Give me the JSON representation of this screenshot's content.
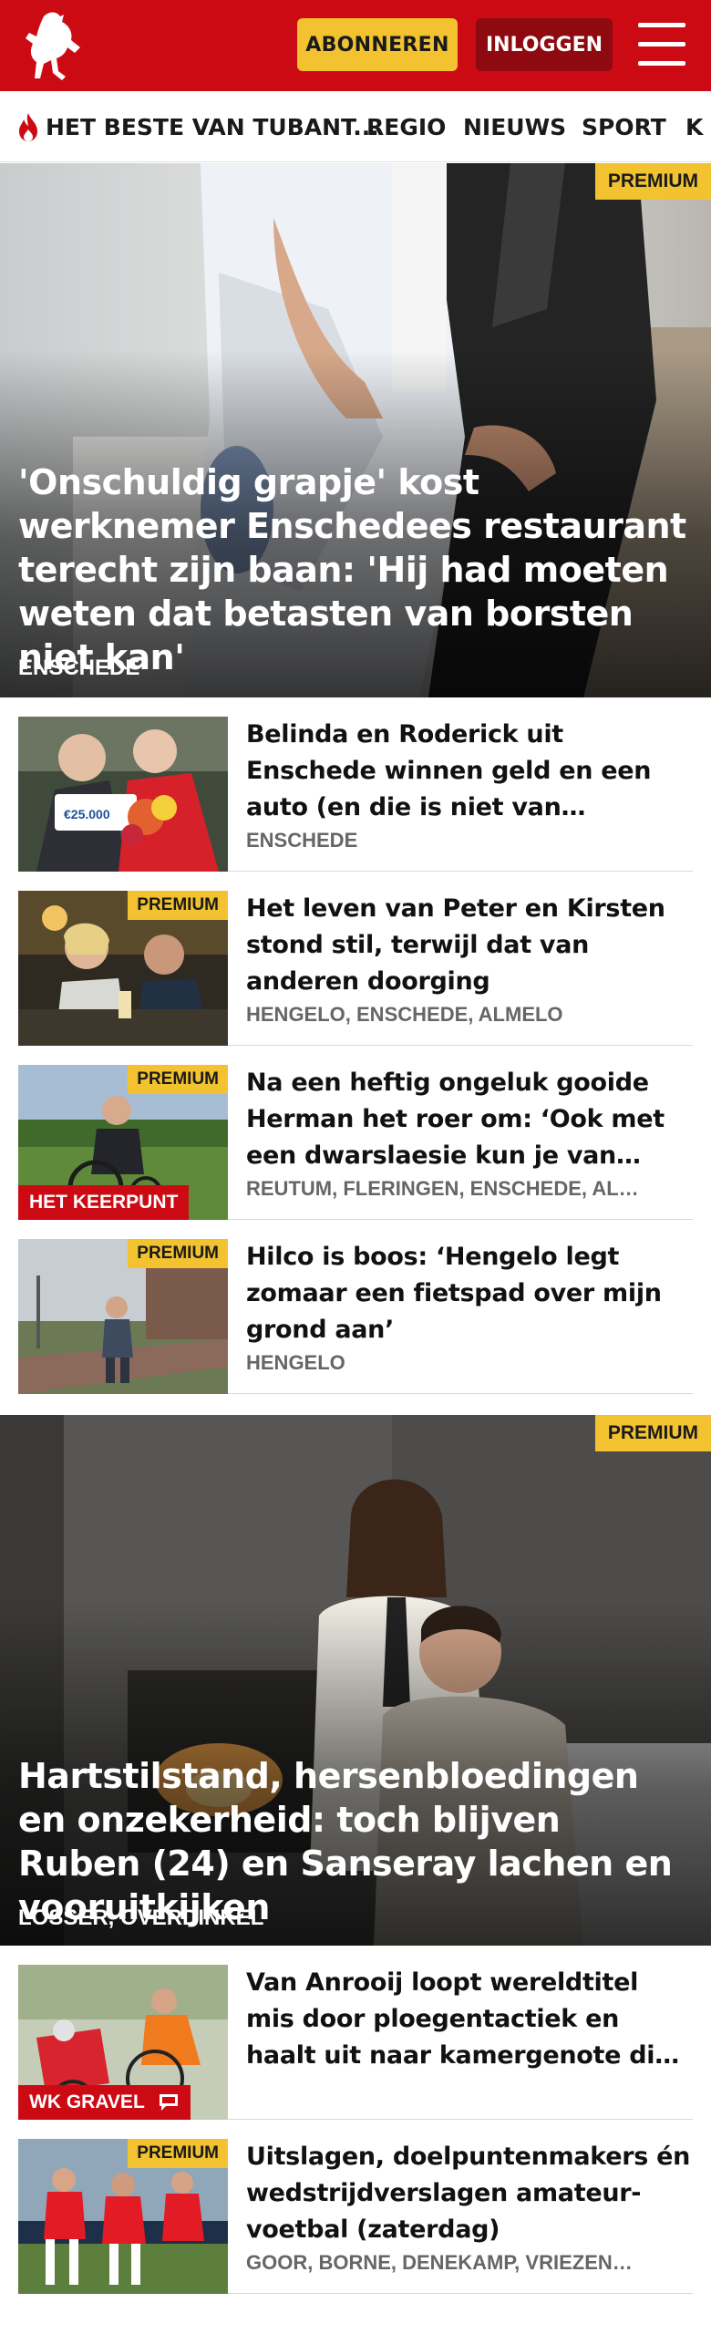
{
  "header": {
    "logo": "tubantia-horse-logo",
    "subscribe_label": "ABONNEREN",
    "login_label": "INLOGGEN",
    "menu_icon": "hamburger-icon",
    "brand_color": "#cc0a14",
    "accent_color": "#f2c230"
  },
  "nav": {
    "items": [
      {
        "label": "HET BESTE VAN TUBANT...",
        "icon": "flame-icon"
      },
      {
        "label": "REGIO"
      },
      {
        "label": "NIEUWS"
      },
      {
        "label": "SPORT"
      },
      {
        "label": "K"
      }
    ]
  },
  "hero1": {
    "badge": "PREMIUM",
    "title": "'Onschuldig grapje' kost werknemer Enschedees restaurant terecht zijn baan: 'Hij had moeten weten dat betasten van borsten niet kan'",
    "location": "ENSCHEDE"
  },
  "articles1": [
    {
      "title": "Belinda en Roderick uit Enschede winnen geld en een auto (en die is niet van speelgoed)",
      "location": "ENSCHEDE",
      "premium": ""
    },
    {
      "title": "Het leven van Peter en Kirsten stond stil, terwijl dat van anderen doorging",
      "location": "HENGELO, ENSCHEDE, ALMELO",
      "premium": "PREMIUM"
    },
    {
      "title": "Na een heftig ongeluk gooide Herman het roer om: ‘Ook met een dwarslaesie kun je van…",
      "location": "REUTUM, FLERINGEN, ENSCHEDE, AL…",
      "premium": "PREMIUM",
      "label": "HET KEERPUNT"
    },
    {
      "title": "Hilco is boos: ‘Hengelo legt zomaar een fietspad over mijn grond aan’",
      "location": "HENGELO",
      "premium": "PREMIUM"
    }
  ],
  "hero2": {
    "badge": "PREMIUM",
    "title": "Hartstilstand, hersenbloedingen en onzekerheid: toch blijven Ruben (24) en Sanseray lachen en vooruitkijken",
    "location": "LOSSER, OVERDINKEL"
  },
  "articles2": [
    {
      "title": "Van Anrooij loopt wereldtitel mis door ploegentactiek en haalt uit naar kamergenote die Wiebes…",
      "location": "",
      "label": "WK GRAVEL",
      "icon": "comment-icon"
    },
    {
      "title": "Uitslagen, doelpuntenmakers én wedstrijdverslagen amateur-voetbal (zaterdag)",
      "location": "GOOR, BORNE, DENEKAMP, VRIEZEN…",
      "premium": "PREMIUM"
    }
  ]
}
